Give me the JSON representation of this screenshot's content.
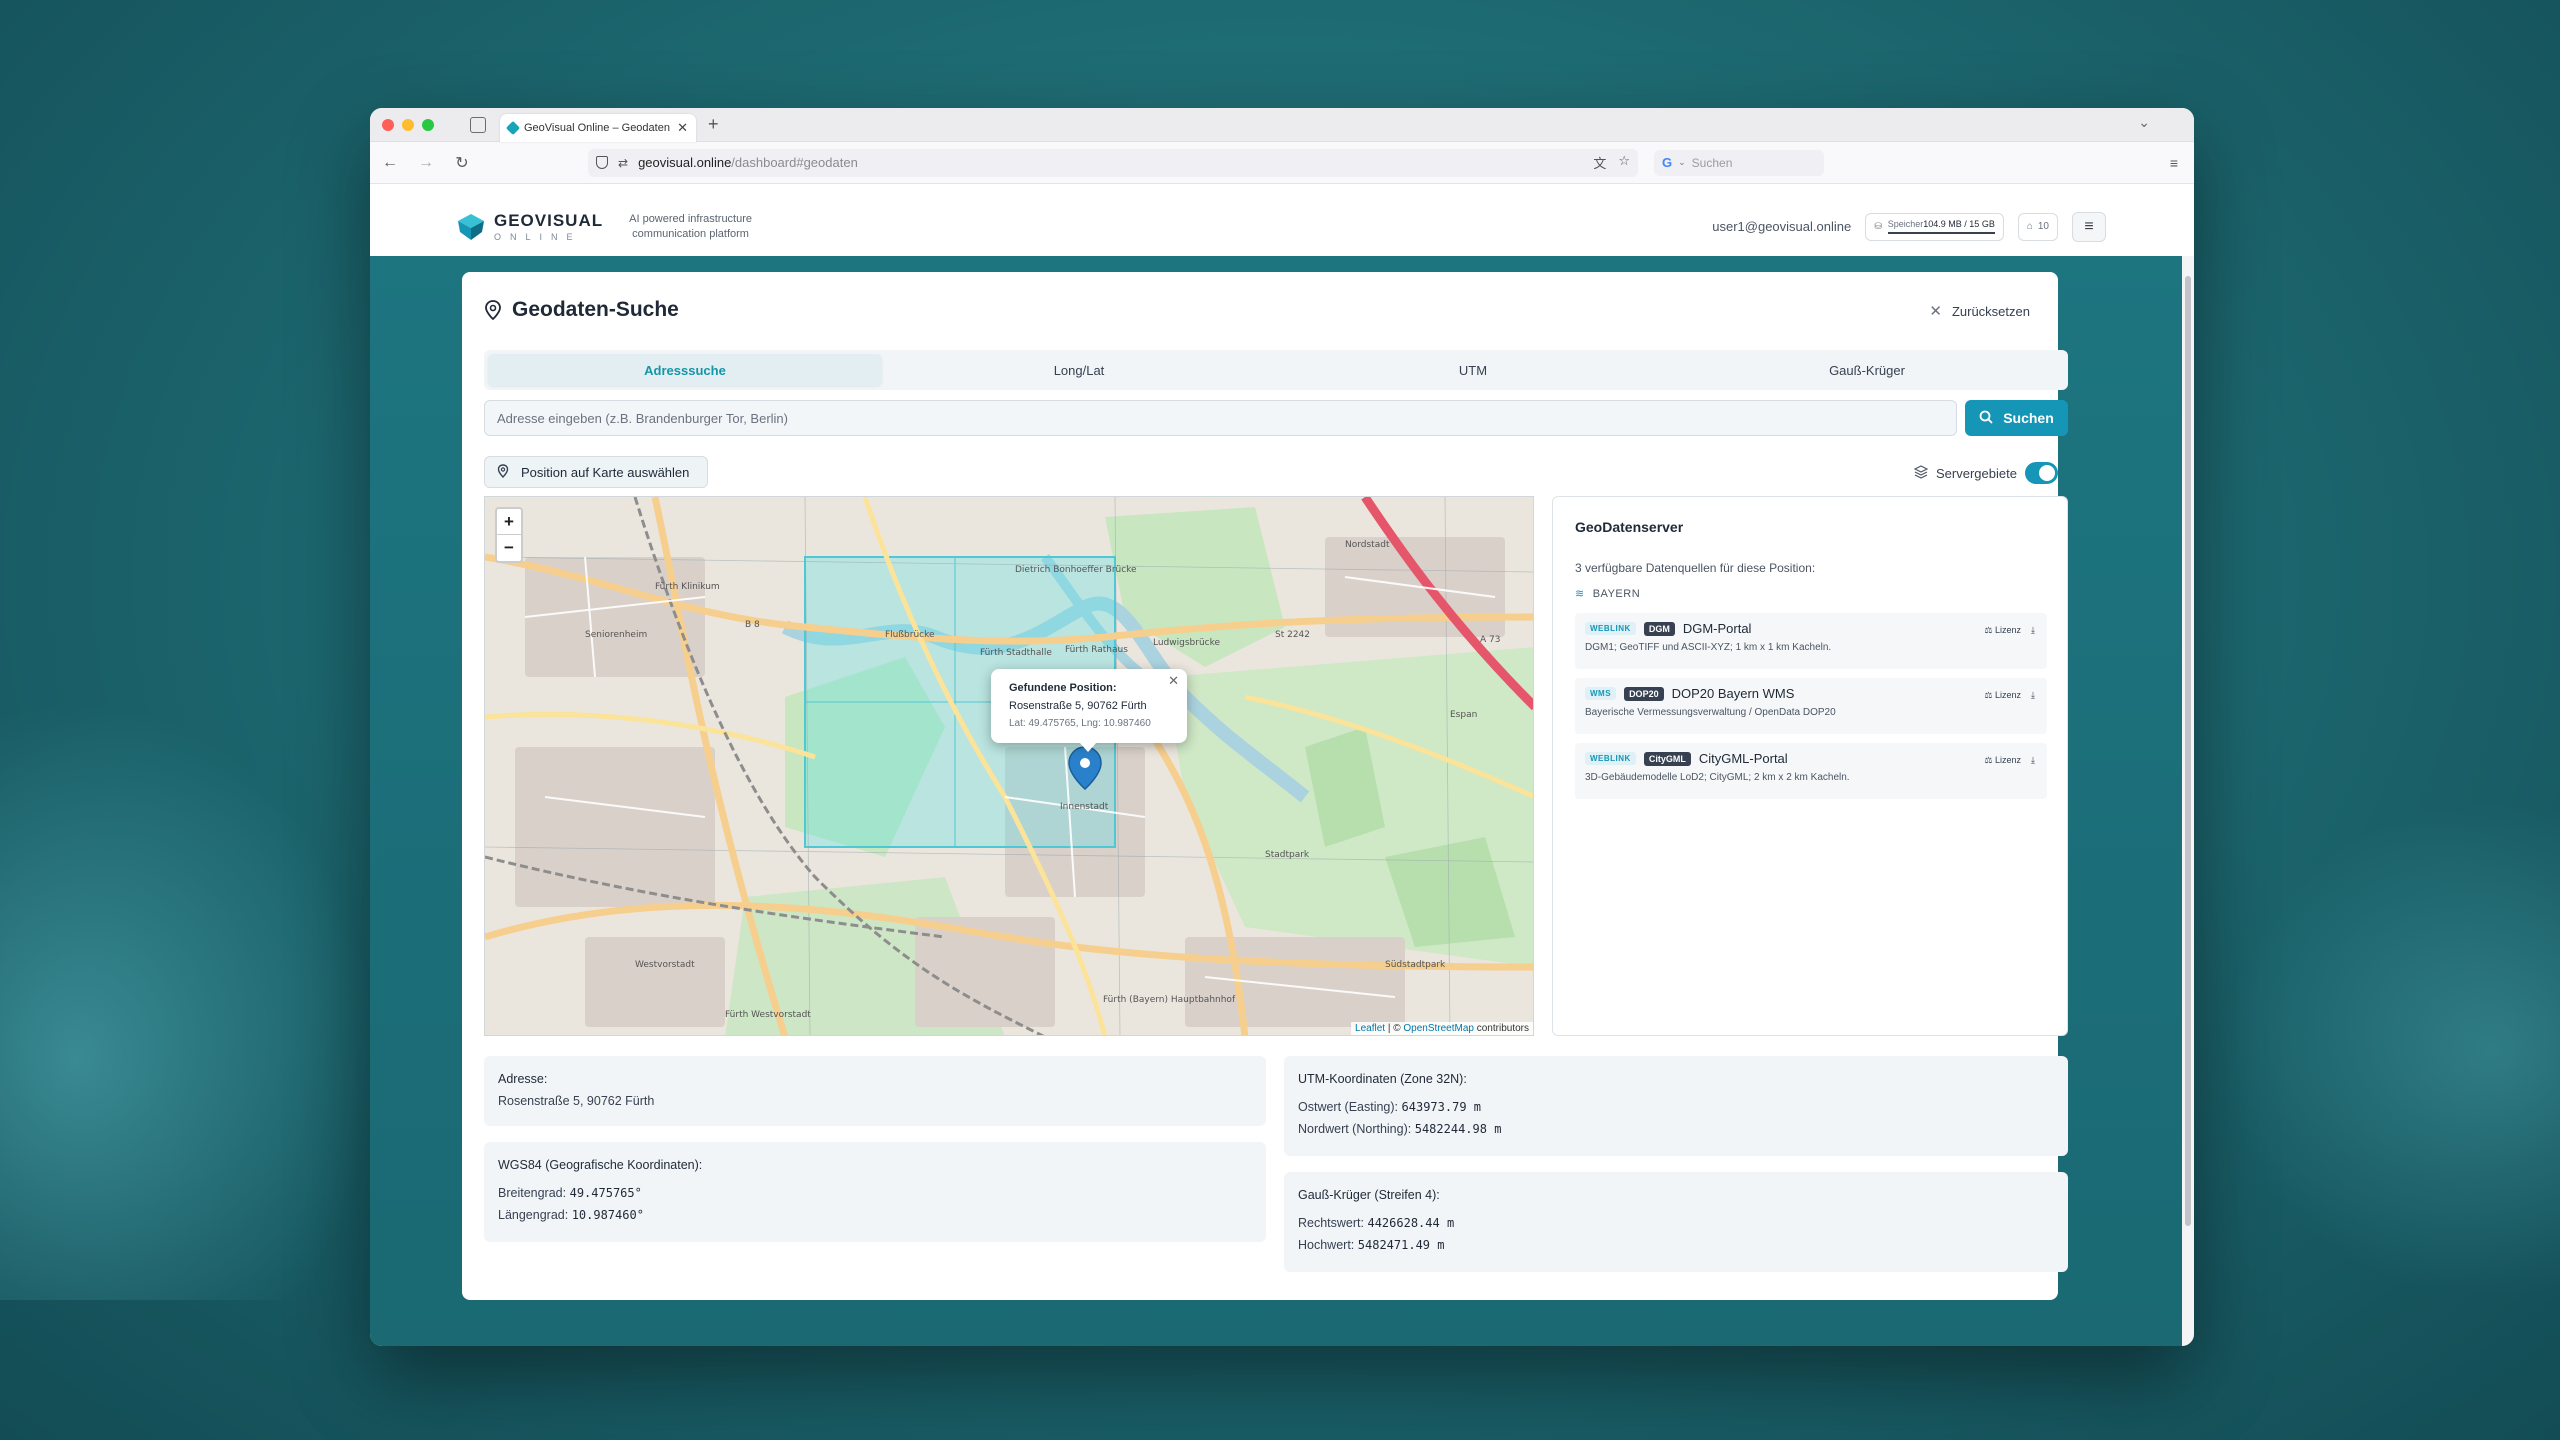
{
  "browser": {
    "tab_title": "GeoVisual Online – Geodaten &",
    "url_domain": "geovisual.online",
    "url_path": "/dashboard#geodaten",
    "search_placeholder": "Suchen"
  },
  "header": {
    "logo_name": "GEOVISUAL",
    "logo_sub": "ONLINE",
    "tagline_1": "AI powered infrastructure",
    "tagline_2": "communication platform",
    "user_email": "user1@geovisual.online",
    "storage_label": "Speicher",
    "storage_value": "104.9 MB / 15 GB",
    "tokens": "10"
  },
  "page": {
    "title": "Geodaten-Suche",
    "reset_label": "Zurücksetzen",
    "tabs": [
      "Adresssuche",
      "Long/Lat",
      "UTM",
      "Gauß-Krüger"
    ],
    "active_tab": "Adresssuche",
    "address_placeholder": "Adresse eingeben (z.B. Brandenburger Tor, Berlin)",
    "search_button": "Suchen",
    "pick_position_button": "Position auf Karte auswählen",
    "server_toggle_label": "Servergebiete",
    "server_toggle_on": true
  },
  "map": {
    "popup_title": "Gefundene Position:",
    "popup_address": "Rosenstraße 5, 90762 Fürth",
    "popup_coords": "Lat: 49.475765, Lng: 10.987460",
    "attribution_leaflet": "Leaflet",
    "attribution_sep": "| ©",
    "attribution_osm": "OpenStreetMap",
    "attribution_tail": "contributors",
    "labels": [
      "Fürth Klinikum",
      "Seniorenheim",
      "Flußbrücke",
      "Fürth Stadthalle",
      "Fürth Rathaus",
      "Innenstadt",
      "Ludwigsbrücke",
      "Espan",
      "Stadtpark",
      "Westvorstadt",
      "Fürth Westvorstadt",
      "Fürth (Bayern) Hauptbahnhof",
      "Südstadtpark",
      "Dietrich Bonhoeffer Brücke",
      "Nordstadt",
      "St 2242",
      "B 8",
      "A 73"
    ]
  },
  "geo_server": {
    "title": "GeoDatenserver",
    "subtitle": "3 verfügbare Datenquellen für diese Position:",
    "region": "BAYERN",
    "sources": [
      {
        "type": "WEBLINK",
        "format": "DGM",
        "name": "DGM-Portal",
        "desc": "DGM1; GeoTIFF und ASCII-XYZ; 1 km x 1 km Kacheln.",
        "license": "Lizenz"
      },
      {
        "type": "WMS",
        "format": "DOP20",
        "name": "DOP20 Bayern WMS",
        "desc": "Bayerische Vermessungsverwaltung / OpenData DOP20",
        "license": "Lizenz"
      },
      {
        "type": "WEBLINK",
        "format": "CityGML",
        "name": "CityGML-Portal",
        "desc": "3D-Gebäudemodelle LoD2; CityGML; 2 km x 2 km Kacheln.",
        "license": "Lizenz"
      }
    ]
  },
  "results": {
    "address_label": "Adresse:",
    "address_value": "Rosenstraße 5, 90762 Fürth",
    "wgs_label": "WGS84 (Geografische Koordinaten):",
    "lat_label": "Breitengrad:",
    "lat_value": "49.475765°",
    "lng_label": "Längengrad:",
    "lng_value": "10.987460°",
    "utm_label": "UTM-Koordinaten (Zone 32N):",
    "easting_label": "Ostwert (Easting):",
    "easting_value": "643973.79 m",
    "northing_label": "Nordwert (Northing):",
    "northing_value": "5482244.98 m",
    "gk_label": "Gauß-Krüger (Streifen 4):",
    "rechts_label": "Rechtswert:",
    "rechts_value": "4426628.44 m",
    "hoch_label": "Hochwert:",
    "hoch_value": "5482471.49 m"
  },
  "colors": {
    "accent": "#1596b6",
    "background": "#1e6b73"
  }
}
